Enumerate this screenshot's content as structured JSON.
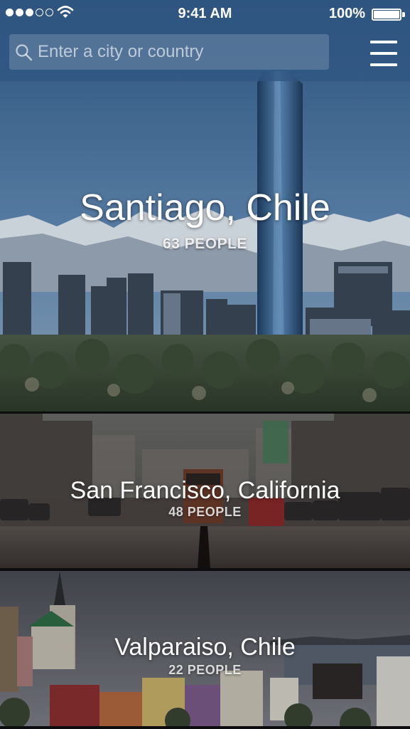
{
  "status_bar": {
    "time": "9:41 AM",
    "battery_percent": "100%",
    "signal_bars_filled": 3,
    "signal_bars_total": 5
  },
  "header": {
    "search_placeholder": "Enter a city or country",
    "search_icon": "search-icon",
    "menu_icon": "hamburger-menu-icon"
  },
  "cities": [
    {
      "name": "Santiago, Chile",
      "count": "63 PEOPLE"
    },
    {
      "name": "San Francisco, California",
      "count": "48 PEOPLE"
    },
    {
      "name": "Valparaiso, Chile",
      "count": "22 PEOPLE"
    }
  ],
  "colors": {
    "header_overlay": "#305682",
    "background": "#0d0d10"
  }
}
